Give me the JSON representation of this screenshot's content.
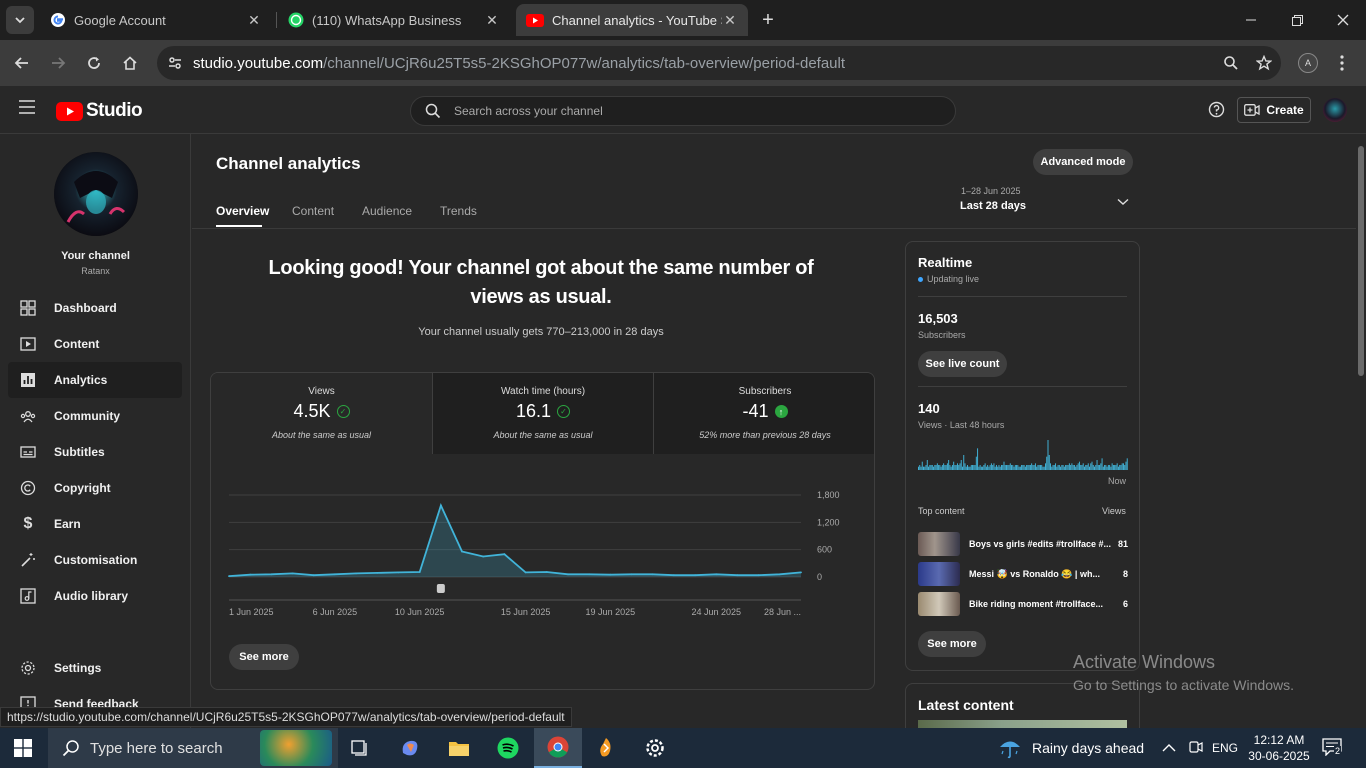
{
  "browser": {
    "tabs": [
      {
        "title": "Google Account"
      },
      {
        "title": "(110) WhatsApp Business"
      },
      {
        "title": "Channel analytics - YouTube Studio"
      }
    ],
    "url_host": "studio.youtube.com",
    "url_path": "/channel/UCjR6u25T5s5-2KSGhOP077w/analytics/tab-overview/period-default",
    "profile_initial": "A",
    "status_url": "https://studio.youtube.com/channel/UCjR6u25T5s5-2KSGhOP077w/analytics/tab-overview/period-default"
  },
  "header": {
    "logo_text": "Studio",
    "search_placeholder": "Search across your channel",
    "create_label": "Create"
  },
  "sidebar": {
    "channel_title": "Your channel",
    "channel_name": "Ratanx",
    "items": [
      {
        "label": "Dashboard",
        "icon": "dashboard-icon"
      },
      {
        "label": "Content",
        "icon": "content-icon"
      },
      {
        "label": "Analytics",
        "icon": "analytics-icon"
      },
      {
        "label": "Community",
        "icon": "community-icon"
      },
      {
        "label": "Subtitles",
        "icon": "subtitles-icon"
      },
      {
        "label": "Copyright",
        "icon": "copyright-icon"
      },
      {
        "label": "Earn",
        "icon": "dollar-icon"
      },
      {
        "label": "Customisation",
        "icon": "magic-wand-icon"
      },
      {
        "label": "Audio library",
        "icon": "audio-library-icon"
      }
    ],
    "settings_label": "Settings",
    "feedback_label": "Send feedback"
  },
  "main": {
    "title": "Channel analytics",
    "advanced_mode_label": "Advanced mode",
    "tabs": [
      "Overview",
      "Content",
      "Audience",
      "Trends"
    ],
    "date_range": "1–28 Jun 2025",
    "date_label": "Last 28 days",
    "headline": "Looking good! Your channel got about the same number of views as usual.",
    "subline": "Your channel usually gets 770–213,000 in 28 days",
    "metrics": [
      {
        "label": "Views",
        "value": "4.5K",
        "note": "About the same as usual",
        "status": "check"
      },
      {
        "label": "Watch time (hours)",
        "value": "16.1",
        "note": "About the same as usual",
        "status": "check"
      },
      {
        "label": "Subscribers",
        "value": "-41",
        "note": "52% more than previous 28 days",
        "status": "up"
      }
    ],
    "see_more_label": "See more"
  },
  "chart_data": {
    "type": "line",
    "x_tick_labels": [
      "1 Jun 2025",
      "6 Jun 2025",
      "10 Jun 2025",
      "15 Jun 2025",
      "19 Jun 2025",
      "24 Jun 2025",
      "28 Jun ..."
    ],
    "y_tick_labels": [
      "1,800",
      "1,200",
      "600",
      "0"
    ],
    "ylim": [
      0,
      1800
    ],
    "grid": true,
    "series": [
      {
        "color": "#41b4d9",
        "x": [
          "1 Jun",
          "2 Jun",
          "3 Jun",
          "4 Jun",
          "5 Jun",
          "6 Jun",
          "7 Jun",
          "8 Jun",
          "9 Jun",
          "10 Jun",
          "11 Jun",
          "12 Jun",
          "13 Jun",
          "14 Jun",
          "15 Jun",
          "16 Jun",
          "17 Jun",
          "18 Jun",
          "19 Jun",
          "20 Jun",
          "21 Jun",
          "22 Jun",
          "23 Jun",
          "24 Jun",
          "25 Jun",
          "26 Jun",
          "27 Jun",
          "28 Jun"
        ],
        "values": [
          20,
          50,
          60,
          80,
          40,
          60,
          80,
          90,
          100,
          110,
          1570,
          560,
          450,
          500,
          100,
          110,
          60,
          60,
          50,
          60,
          60,
          40,
          40,
          60,
          40,
          40,
          60,
          100
        ]
      }
    ]
  },
  "realtime": {
    "title": "Realtime",
    "updating": "Updating live",
    "subscribers_value": "16,503",
    "subscribers_label": "Subscribers",
    "see_live_count": "See live count",
    "views_value": "140",
    "views_label": "Views · Last 48 hours",
    "now_label": "Now",
    "bars": [
      2,
      3,
      2,
      5,
      2,
      2,
      3,
      6,
      2,
      3,
      3,
      3,
      2,
      3,
      3,
      4,
      3,
      3,
      2,
      3,
      4,
      3,
      3,
      4,
      6,
      3,
      2,
      3,
      5,
      3,
      3,
      4,
      3,
      4,
      6,
      2,
      9,
      4,
      2,
      3,
      2,
      2,
      3,
      3,
      3,
      3,
      8,
      13,
      2,
      3,
      2,
      2,
      3,
      4,
      2,
      3,
      2,
      3,
      4,
      3,
      4,
      2,
      3,
      2,
      3,
      2,
      3,
      3,
      5,
      3,
      3,
      3,
      3,
      4,
      3,
      3,
      2,
      3,
      3,
      3,
      2,
      2,
      3,
      3,
      3,
      2,
      3,
      3,
      3,
      3,
      4,
      3,
      3,
      4,
      2,
      3,
      3,
      3,
      3,
      2,
      2,
      4,
      8,
      18,
      9,
      4,
      2,
      3,
      3,
      4,
      2,
      3,
      3,
      2,
      3,
      3,
      2,
      3,
      3,
      3,
      4,
      3,
      4,
      3,
      3,
      2,
      3,
      4,
      5,
      3,
      3,
      4,
      2,
      3,
      3,
      4,
      2,
      4,
      5,
      3,
      2,
      3,
      6,
      3,
      3,
      4,
      7,
      2,
      3,
      3,
      2,
      3,
      3,
      2,
      4,
      3,
      3,
      3,
      4,
      2,
      3,
      3,
      4,
      4,
      3,
      5,
      7
    ],
    "top_content_label": "Top content",
    "views_col_label": "Views",
    "top_items": [
      {
        "title": "Boys vs girls #edits #trollface #...",
        "views": "81"
      },
      {
        "title": "Messi 🤯 vs Ronaldo 😂 | wh...",
        "views": "8"
      },
      {
        "title": "Bike riding moment #trollface...",
        "views": "6"
      }
    ],
    "see_more_label": "See more"
  },
  "latest": {
    "title": "Latest content"
  },
  "watermark": {
    "line1": "Activate Windows",
    "line2": "Go to Settings to activate Windows."
  },
  "taskbar": {
    "search_placeholder": "Type here to search",
    "weather": "Rainy days ahead",
    "lang": "ENG",
    "time": "12:12 AM",
    "date": "30-06-2025",
    "notifications": "2"
  },
  "colors": {
    "accent_blue": "#3ea6ff",
    "chart_line": "#41b4d9",
    "success_green": "#2ba640",
    "youtube_red": "#ff0000"
  }
}
